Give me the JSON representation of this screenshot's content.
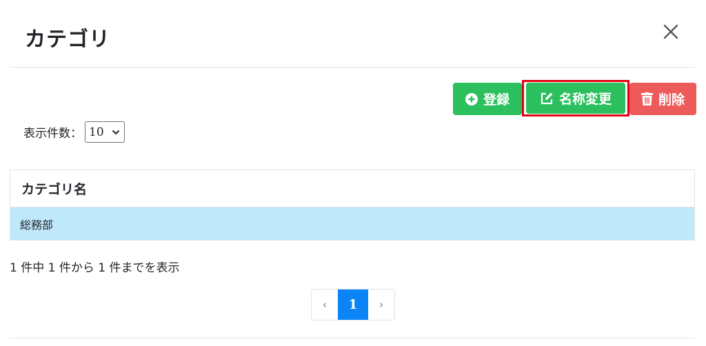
{
  "modal": {
    "title": "カテゴリ"
  },
  "toolbar": {
    "register_label": "登録",
    "rename_label": "名称変更",
    "delete_label": "削除"
  },
  "perpage": {
    "label": "表示件数：",
    "value": "10"
  },
  "table": {
    "header": "カテゴリ名",
    "rows": [
      {
        "name": "総務部"
      }
    ]
  },
  "info": "1 件中 1 件から 1 件までを表示",
  "pagination": {
    "prev": "‹",
    "current": "1",
    "next": "›"
  },
  "colors": {
    "success": "#2bbf5e",
    "danger": "#ec5a5a",
    "highlight": "#e3000f",
    "selected_row": "#bfe8fb",
    "active_page": "#0b84f5"
  }
}
